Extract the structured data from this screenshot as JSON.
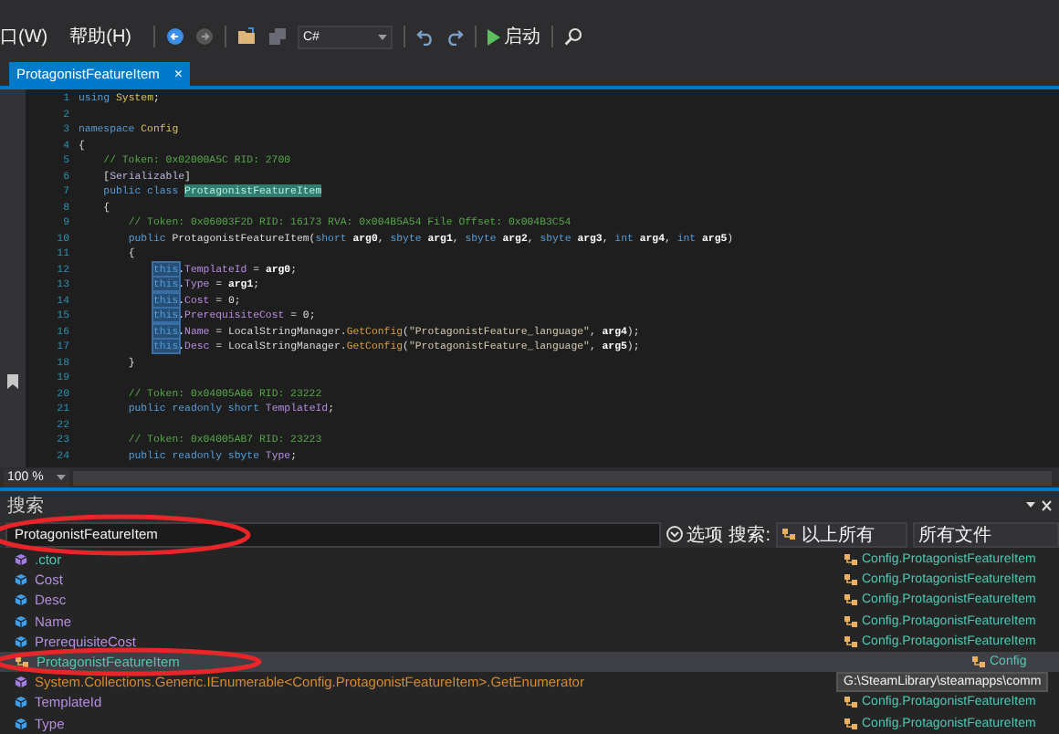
{
  "menu": [
    {
      "label": "口(W)"
    },
    {
      "label": "帮助(H)"
    }
  ],
  "toolbar": {
    "language": "C#",
    "start": "启动"
  },
  "tabs": [
    {
      "label": "ProtagonistFeatureItem",
      "selected": true,
      "close": "×"
    }
  ],
  "code_lines": [
    {
      "number": "1",
      "tokens": [
        {
          "kind": "keyword",
          "text": "using"
        },
        {
          "kind": "type",
          "text": " System"
        },
        {
          "kind": "plain",
          "text": ";"
        }
      ]
    },
    {
      "number": "2"
    },
    {
      "number": "3",
      "tokens": [
        {
          "kind": "keyword",
          "text": "namespace"
        },
        {
          "kind": "type",
          "text": " Config"
        }
      ]
    },
    {
      "number": "4",
      "tokens": [
        {
          "kind": "plain",
          "text": "{"
        }
      ]
    },
    {
      "number": "5",
      "tokens": [
        {
          "kind": "comment",
          "text": "    // Token: 0x02000A5C RID: 2700"
        }
      ]
    },
    {
      "number": "6",
      "tokens": [
        {
          "kind": "plain",
          "text": "    ["
        },
        {
          "kind": "attribute",
          "text": "Serializable"
        },
        {
          "kind": "plain",
          "text": "]"
        }
      ]
    },
    {
      "number": "7",
      "tokens": [
        {
          "kind": "keyword",
          "text": "    public class "
        },
        {
          "kind": "match",
          "text": "ProtagonistFeatureItem"
        }
      ]
    },
    {
      "number": "8",
      "tokens": [
        {
          "kind": "plain",
          "text": "    {"
        }
      ]
    },
    {
      "number": "9",
      "tokens": [
        {
          "kind": "comment",
          "text": "        // Token: 0x06003F2D RID: 16173 RVA: 0x004B5A54 File Offset: 0x004B3C54"
        }
      ]
    },
    {
      "number": "10",
      "tokens": [
        {
          "kind": "keyword",
          "text": "        public"
        },
        {
          "kind": "plain",
          "text": " ProtagonistFeatureItem("
        },
        {
          "kind": "keyword",
          "text": "short"
        },
        {
          "kind": "param",
          "text": " arg0"
        },
        {
          "kind": "plain",
          "text": ", "
        },
        {
          "kind": "keyword",
          "text": "sbyte"
        },
        {
          "kind": "param",
          "text": " arg1"
        },
        {
          "kind": "plain",
          "text": ", "
        },
        {
          "kind": "keyword",
          "text": "sbyte"
        },
        {
          "kind": "param",
          "text": " arg2"
        },
        {
          "kind": "plain",
          "text": ", "
        },
        {
          "kind": "keyword",
          "text": "sbyte"
        },
        {
          "kind": "param",
          "text": " arg3"
        },
        {
          "kind": "plain",
          "text": ", "
        },
        {
          "kind": "keyword",
          "text": "int"
        },
        {
          "kind": "param",
          "text": " arg4"
        },
        {
          "kind": "plain",
          "text": ", "
        },
        {
          "kind": "keyword",
          "text": "int"
        },
        {
          "kind": "param",
          "text": " arg5"
        },
        {
          "kind": "plain",
          "text": ")"
        }
      ]
    },
    {
      "number": "11",
      "tokens": [
        {
          "kind": "plain",
          "text": "        {"
        }
      ]
    },
    {
      "number": "12",
      "tokens": [
        {
          "kind": "this",
          "text": "            this"
        },
        {
          "kind": "plain",
          "text": "."
        },
        {
          "kind": "member",
          "text": "TemplateId"
        },
        {
          "kind": "plain",
          "text": " = "
        },
        {
          "kind": "param",
          "text": "arg0"
        },
        {
          "kind": "plain",
          "text": ";"
        }
      ]
    },
    {
      "number": "13",
      "tokens": [
        {
          "kind": "this",
          "text": "            this"
        },
        {
          "kind": "plain",
          "text": "."
        },
        {
          "kind": "member",
          "text": "Type"
        },
        {
          "kind": "plain",
          "text": " = "
        },
        {
          "kind": "param",
          "text": "arg1"
        },
        {
          "kind": "plain",
          "text": ";"
        }
      ]
    },
    {
      "number": "14",
      "tokens": [
        {
          "kind": "this",
          "text": "            this"
        },
        {
          "kind": "plain",
          "text": "."
        },
        {
          "kind": "member",
          "text": "Cost"
        },
        {
          "kind": "plain",
          "text": " = 0;"
        }
      ]
    },
    {
      "number": "15",
      "tokens": [
        {
          "kind": "this",
          "text": "            this"
        },
        {
          "kind": "plain",
          "text": "."
        },
        {
          "kind": "member",
          "text": "PrerequisiteCost"
        },
        {
          "kind": "plain",
          "text": " = 0;"
        }
      ]
    },
    {
      "number": "16",
      "tokens": [
        {
          "kind": "this",
          "text": "            this"
        },
        {
          "kind": "plain",
          "text": "."
        },
        {
          "kind": "member",
          "text": "Name"
        },
        {
          "kind": "plain",
          "text": " = LocalStringManager."
        },
        {
          "kind": "method",
          "text": "GetConfig"
        },
        {
          "kind": "plain",
          "text": "("
        },
        {
          "kind": "string",
          "text": "\"ProtagonistFeature_language\""
        },
        {
          "kind": "plain",
          "text": ", "
        },
        {
          "kind": "param",
          "text": "arg4"
        },
        {
          "kind": "plain",
          "text": ");"
        }
      ]
    },
    {
      "number": "17",
      "tokens": [
        {
          "kind": "this",
          "text": "            this"
        },
        {
          "kind": "plain",
          "text": "."
        },
        {
          "kind": "member",
          "text": "Desc"
        },
        {
          "kind": "plain",
          "text": " = LocalStringManager."
        },
        {
          "kind": "method",
          "text": "GetConfig"
        },
        {
          "kind": "plain",
          "text": "("
        },
        {
          "kind": "string",
          "text": "\"ProtagonistFeature_language\""
        },
        {
          "kind": "plain",
          "text": ", "
        },
        {
          "kind": "param",
          "text": "arg5"
        },
        {
          "kind": "plain",
          "text": ");"
        }
      ]
    },
    {
      "number": "18",
      "tokens": [
        {
          "kind": "plain",
          "text": "        }"
        }
      ]
    },
    {
      "number": "19"
    },
    {
      "number": "20",
      "tokens": [
        {
          "kind": "comment",
          "text": "        // Token: 0x04005AB6 RID: 23222"
        }
      ]
    },
    {
      "number": "21",
      "tokens": [
        {
          "kind": "keyword",
          "text": "        public readonly short"
        },
        {
          "kind": "member",
          "text": " TemplateId"
        },
        {
          "kind": "plain",
          "text": ";"
        }
      ]
    },
    {
      "number": "22"
    },
    {
      "number": "23",
      "tokens": [
        {
          "kind": "comment",
          "text": "        // Token: 0x04005AB7 RID: 23223"
        }
      ]
    },
    {
      "number": "24",
      "tokens": [
        {
          "kind": "keyword",
          "text": "        public readonly sbyte"
        },
        {
          "kind": "member",
          "text": " Type"
        },
        {
          "kind": "plain",
          "text": ";"
        }
      ]
    }
  ],
  "zoom": "100 %",
  "search_panel": {
    "title": "搜索",
    "query": "ProtagonistFeatureItem",
    "options": "选项",
    "scope_label": "搜索:",
    "scope": "以上所有",
    "files": "所有文件",
    "results": [
      {
        "kind": "constructor",
        "name": ".ctor",
        "selected": false,
        "location": "Config.ProtagonistFeatureItem"
      },
      {
        "kind": "field",
        "name": "Cost",
        "selected": false,
        "location": "Config.ProtagonistFeatureItem"
      },
      {
        "kind": "field",
        "name": "Desc",
        "selected": false,
        "location": "Config.ProtagonistFeatureItem"
      },
      {
        "kind": "field",
        "name": "Name",
        "selected": false,
        "location": "Config.ProtagonistFeatureItem"
      },
      {
        "kind": "field",
        "name": "PrerequisiteCost",
        "selected": false,
        "location": "Config.ProtagonistFeatureItem"
      },
      {
        "kind": "class",
        "name": "ProtagonistFeatureItem",
        "selected": true,
        "location": "Config"
      },
      {
        "kind": "method",
        "name": "System.Collections.Generic.IEnumerable<Config.ProtagonistFeatureItem>.GetEnumerator",
        "selected": false
      },
      {
        "kind": "field",
        "name": "TemplateId",
        "selected": false,
        "location": "Config.ProtagonistFeatureItem"
      },
      {
        "kind": "field",
        "name": "Type",
        "selected": false,
        "location": "Config.ProtagonistFeatureItem"
      }
    ],
    "tooltip": "G:\\SteamLibrary\\steamapps\\comm"
  }
}
